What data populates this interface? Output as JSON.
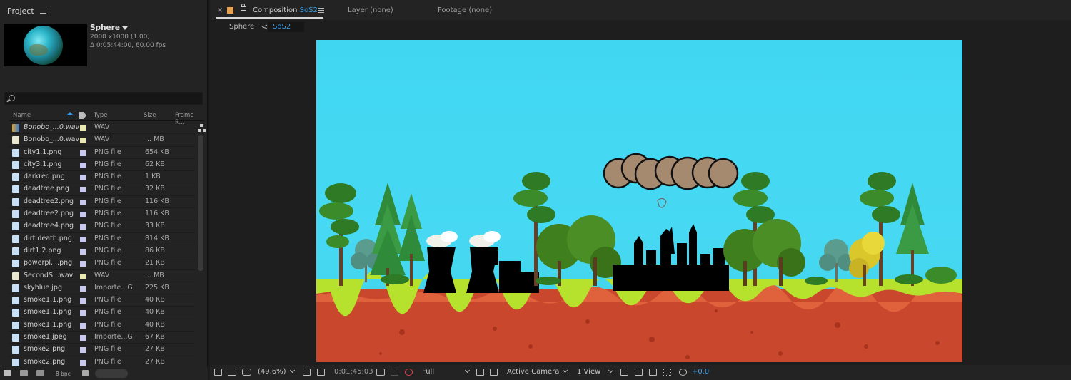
{
  "project_panel": {
    "title": "Project",
    "comp": {
      "name": "Sphere",
      "dimensions": "2000 x1000 (1.00)",
      "duration": "Δ 0:05:44:00, 60.00 fps"
    },
    "search": {
      "value": "",
      "placeholder": ""
    },
    "columns": {
      "name": "Name",
      "type": "Type",
      "size": "Size",
      "frame_rate": "Frame R..."
    },
    "files": [
      {
        "name": "Bonobo_...0.wav",
        "type": "WAV",
        "size": "",
        "icon": "audio-footage-icon",
        "label_color": "#e8e8b0",
        "italic": true
      },
      {
        "name": "Bonobo_...0.wav",
        "type": "WAV",
        "size": "... MB",
        "icon": "wav-file-icon",
        "label_color": "#e8e8b0",
        "italic": false
      },
      {
        "name": "city1.1.png",
        "type": "PNG file",
        "size": "654 KB",
        "icon": "image-file-icon",
        "label_color": "#c9c9f0",
        "italic": false
      },
      {
        "name": "city3.1.png",
        "type": "PNG file",
        "size": "62 KB",
        "icon": "image-file-icon",
        "label_color": "#c9c9f0",
        "italic": false
      },
      {
        "name": "darkred.png",
        "type": "PNG file",
        "size": "1 KB",
        "icon": "image-file-icon",
        "label_color": "#c9c9f0",
        "italic": false
      },
      {
        "name": "deadtree.png",
        "type": "PNG file",
        "size": "32 KB",
        "icon": "image-file-icon",
        "label_color": "#c9c9f0",
        "italic": false
      },
      {
        "name": "deadtree2.png",
        "type": "PNG file",
        "size": "116 KB",
        "icon": "image-file-icon",
        "label_color": "#c9c9f0",
        "italic": false
      },
      {
        "name": "deadtree2.png",
        "type": "PNG file",
        "size": "116 KB",
        "icon": "image-file-icon",
        "label_color": "#c9c9f0",
        "italic": false
      },
      {
        "name": "deadtree4.png",
        "type": "PNG file",
        "size": "33 KB",
        "icon": "image-file-icon",
        "label_color": "#c9c9f0",
        "italic": false
      },
      {
        "name": "dirt.death.png",
        "type": "PNG file",
        "size": "814 KB",
        "icon": "image-file-icon",
        "label_color": "#c9c9f0",
        "italic": false
      },
      {
        "name": "dirt1.2.png",
        "type": "PNG file",
        "size": "86 KB",
        "icon": "image-file-icon",
        "label_color": "#c9c9f0",
        "italic": false
      },
      {
        "name": "powerpl....png",
        "type": "PNG file",
        "size": "21 KB",
        "icon": "image-file-icon",
        "label_color": "#c9c9f0",
        "italic": false
      },
      {
        "name": "SecondS...wav",
        "type": "WAV",
        "size": "... MB",
        "icon": "wav-file-icon",
        "label_color": "#e8e8b0",
        "italic": false
      },
      {
        "name": "skyblue.jpg",
        "type": "Importe...G",
        "size": "225 KB",
        "icon": "image-file-icon",
        "label_color": "#c9c9f0",
        "italic": false
      },
      {
        "name": "smoke1.1.png",
        "type": "PNG file",
        "size": "40 KB",
        "icon": "image-file-icon",
        "label_color": "#c9c9f0",
        "italic": false
      },
      {
        "name": "smoke1.1.png",
        "type": "PNG file",
        "size": "40 KB",
        "icon": "image-file-icon",
        "label_color": "#c9c9f0",
        "italic": false
      },
      {
        "name": "smoke1.1.png",
        "type": "PNG file",
        "size": "40 KB",
        "icon": "image-file-icon",
        "label_color": "#c9c9f0",
        "italic": false
      },
      {
        "name": "smoke1.jpeg",
        "type": "Importe...G",
        "size": "67 KB",
        "icon": "image-file-icon",
        "label_color": "#c9c9f0",
        "italic": false
      },
      {
        "name": "smoke2.png",
        "type": "PNG file",
        "size": "27 KB",
        "icon": "image-file-icon",
        "label_color": "#c9c9f0",
        "italic": false
      },
      {
        "name": "smoke2.png",
        "type": "PNG file",
        "size": "27 KB",
        "icon": "image-file-icon",
        "label_color": "#c9c9f0",
        "italic": false
      }
    ],
    "footer": {
      "bpc": "8 bpc"
    }
  },
  "composition_panel": {
    "tabs": {
      "close": "×",
      "comp_prefix": "Composition",
      "comp_name": "SoS2",
      "layer": "Layer (none)",
      "footage": "Footage (none)"
    },
    "breadcrumbs": {
      "parent": "Sphere",
      "separator": "<",
      "current": "SoS2"
    },
    "toolbar": {
      "zoom": "(49.6%)",
      "timecode": "0:01:45:03",
      "resolution": "Full",
      "camera": "Active Camera",
      "views": "1 View",
      "exposure": "+0.0"
    }
  },
  "colors": {
    "accent": "#3d9ee6",
    "sky": "#47d9f3",
    "dirt": "#c9472c",
    "grass": "#b6e22d",
    "comp_label": "#e8a24f"
  }
}
